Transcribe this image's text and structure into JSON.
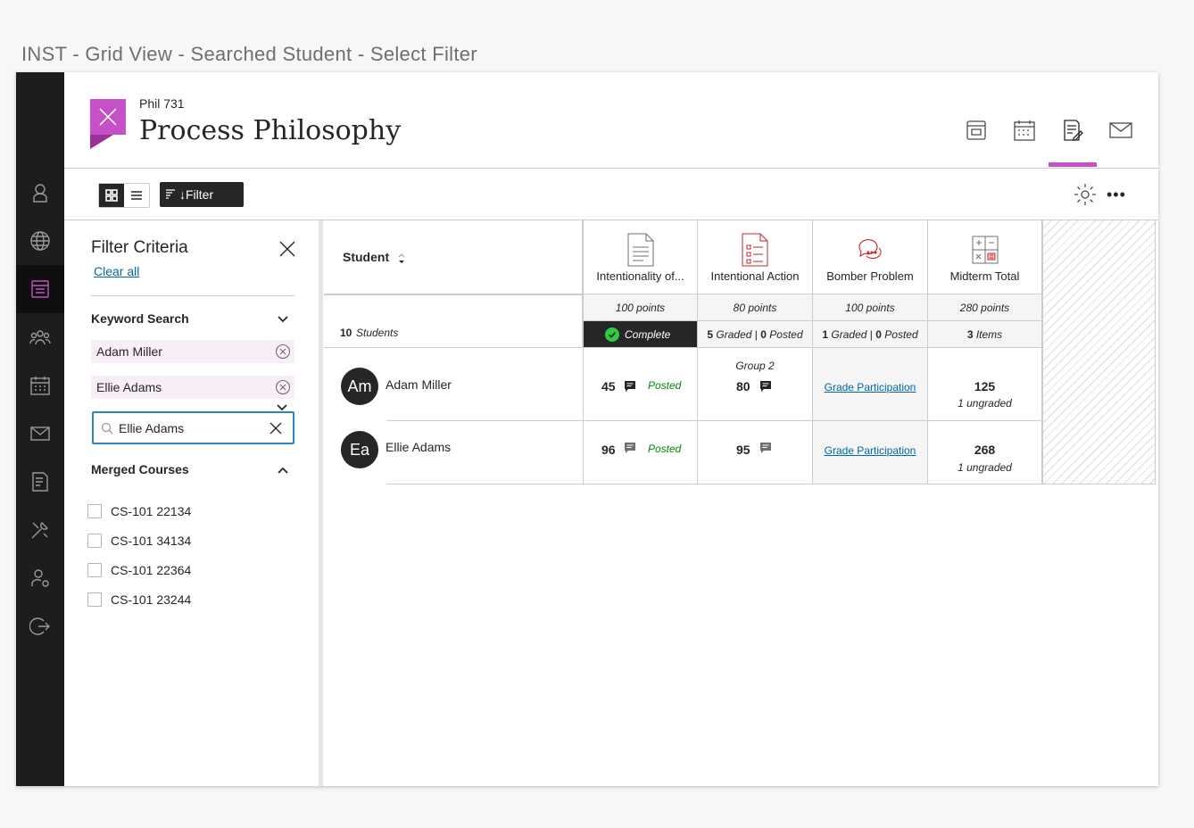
{
  "page_caption": "INST - Grid View - Searched Student - Select Filter",
  "course": {
    "code": "Phil 731",
    "title": "Process Philosophy"
  },
  "toolbar": {
    "filter_label": "↓Filter"
  },
  "filter_panel": {
    "title": "Filter Criteria",
    "clear_all": "Clear all",
    "keyword_section": "Keyword Search",
    "keywords": [
      "Adam Miller",
      "Ellie Adams"
    ],
    "search_value": "Ellie Adams",
    "merged_section": "Merged Courses",
    "courses": [
      "CS-101 22134",
      "CS-101 34134",
      "CS-101 22364",
      "CS-101 23244"
    ]
  },
  "grid": {
    "student_header": "Student",
    "student_count": "10",
    "student_count_label": "Students",
    "columns": [
      {
        "title": "Intentionality of...",
        "points": "100 points",
        "icon": "document-icon"
      },
      {
        "title": "Intentional Action",
        "points": "80 points",
        "icon": "test-icon"
      },
      {
        "title": "Bomber Problem",
        "points": "100 points",
        "icon": "discussion-icon"
      },
      {
        "title": "Midterm Total",
        "points": "280 points",
        "icon": "calculator-icon"
      }
    ],
    "summary": {
      "col0": "Complete",
      "col1_graded": "5",
      "col1_graded_label": "Graded",
      "col1_sep": "|",
      "col1_posted": "0",
      "col1_posted_label": "Posted",
      "col2_graded": "1",
      "col2_graded_label": "Graded",
      "col2_sep": "|",
      "col2_posted": "0",
      "col2_posted_label": "Posted",
      "col3_items": "3",
      "col3_items_label": "Items"
    },
    "rows": [
      {
        "initials": "Am",
        "name": "Adam Miller",
        "c0_grade": "45",
        "c0_status": "Posted",
        "c1_group": "Group 2",
        "c1_grade": "80",
        "c2_link": "Grade Participation",
        "c3_total": "125",
        "c3_note": "1 ungraded"
      },
      {
        "initials": "Ea",
        "name": "Ellie Adams",
        "c0_grade": "96",
        "c0_status": "Posted",
        "c1_grade": "95",
        "c2_link": "Grade Participation",
        "c3_total": "268",
        "c3_note": "1 ungraded"
      }
    ]
  },
  "colors": {
    "accent": "#c650c6",
    "link": "#0068a5",
    "posted": "#008a00",
    "complete": "#2ecc40",
    "rail": "#1d1d1d"
  }
}
